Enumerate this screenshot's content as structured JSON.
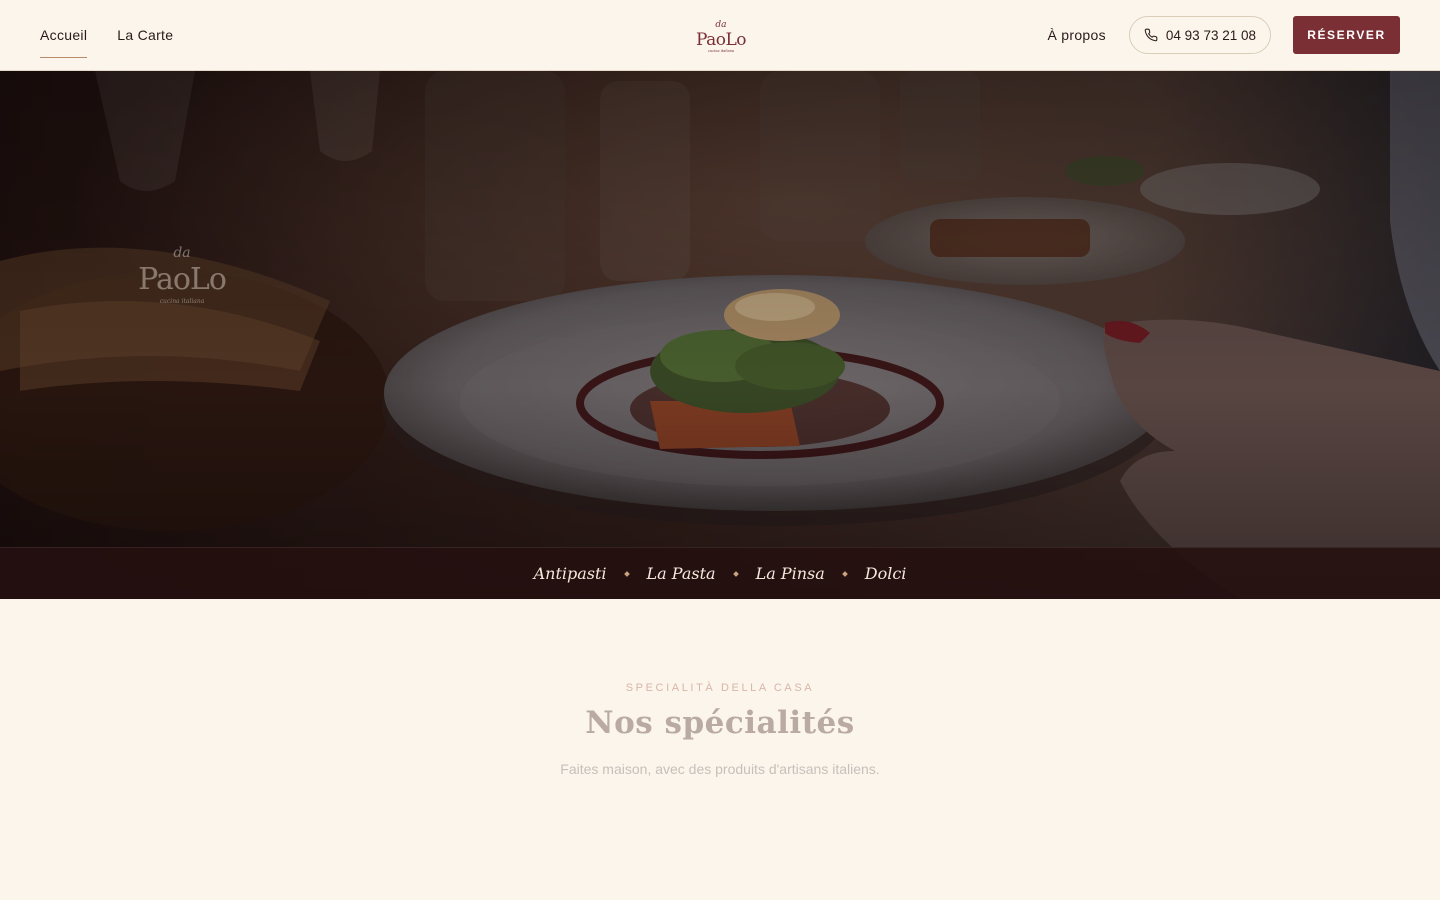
{
  "header": {
    "nav": [
      {
        "label": "Accueil",
        "active": true
      },
      {
        "label": "La Carte",
        "active": false
      }
    ],
    "logo": {
      "top": "da",
      "main": "PaoLo",
      "tagline": "cucina italiana"
    },
    "about_label": "À propos",
    "phone": "04 93 73 21 08",
    "reserve_label": "RÉSERVER"
  },
  "hero": {
    "categories": [
      "Antipasti",
      "La Pasta",
      "La Pinsa",
      "Dolci"
    ]
  },
  "specialties": {
    "kicker": "SPECIALITÀ DELLA CASA",
    "title": "Nos spécialités",
    "subtitle": "Faites maison, avec des produits d'artisans italiens."
  },
  "colors": {
    "background": "#fbf5ec",
    "accent": "#7a2f35",
    "category_bar": "#261010"
  }
}
